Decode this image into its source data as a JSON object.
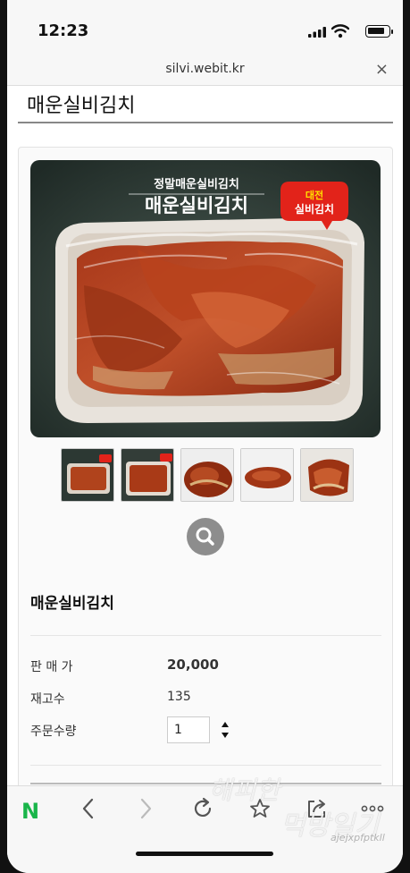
{
  "status": {
    "time": "12:23"
  },
  "browser": {
    "url": "silvi.webit.kr",
    "close_label": "×"
  },
  "page": {
    "title": "매운실비김치"
  },
  "product": {
    "image_banner_top": "정말매운실비김치",
    "image_banner_main": "매운실비김치",
    "image_badge": "대전\n실비김치",
    "name": "매운실비김치",
    "price_label": "판 매 가",
    "price": "20,000",
    "stock_label": "재고수",
    "stock": "135",
    "order_qty_label": "주문수량",
    "order_qty": "1"
  },
  "thumbnails": [
    {
      "name": "thumb-package-1"
    },
    {
      "name": "thumb-package-2"
    },
    {
      "name": "thumb-kimchi-bowl"
    },
    {
      "name": "thumb-kimchi-plate"
    },
    {
      "name": "thumb-kimchi-closeup"
    }
  ],
  "toolbar": {
    "naver_label": "N"
  },
  "watermark": {
    "line1": "해피한",
    "line2": "먹방일기",
    "line3": "ajejxpfptkll"
  },
  "colors": {
    "naver_green": "#19b54a",
    "zoom_button": "#8d8d8d"
  }
}
